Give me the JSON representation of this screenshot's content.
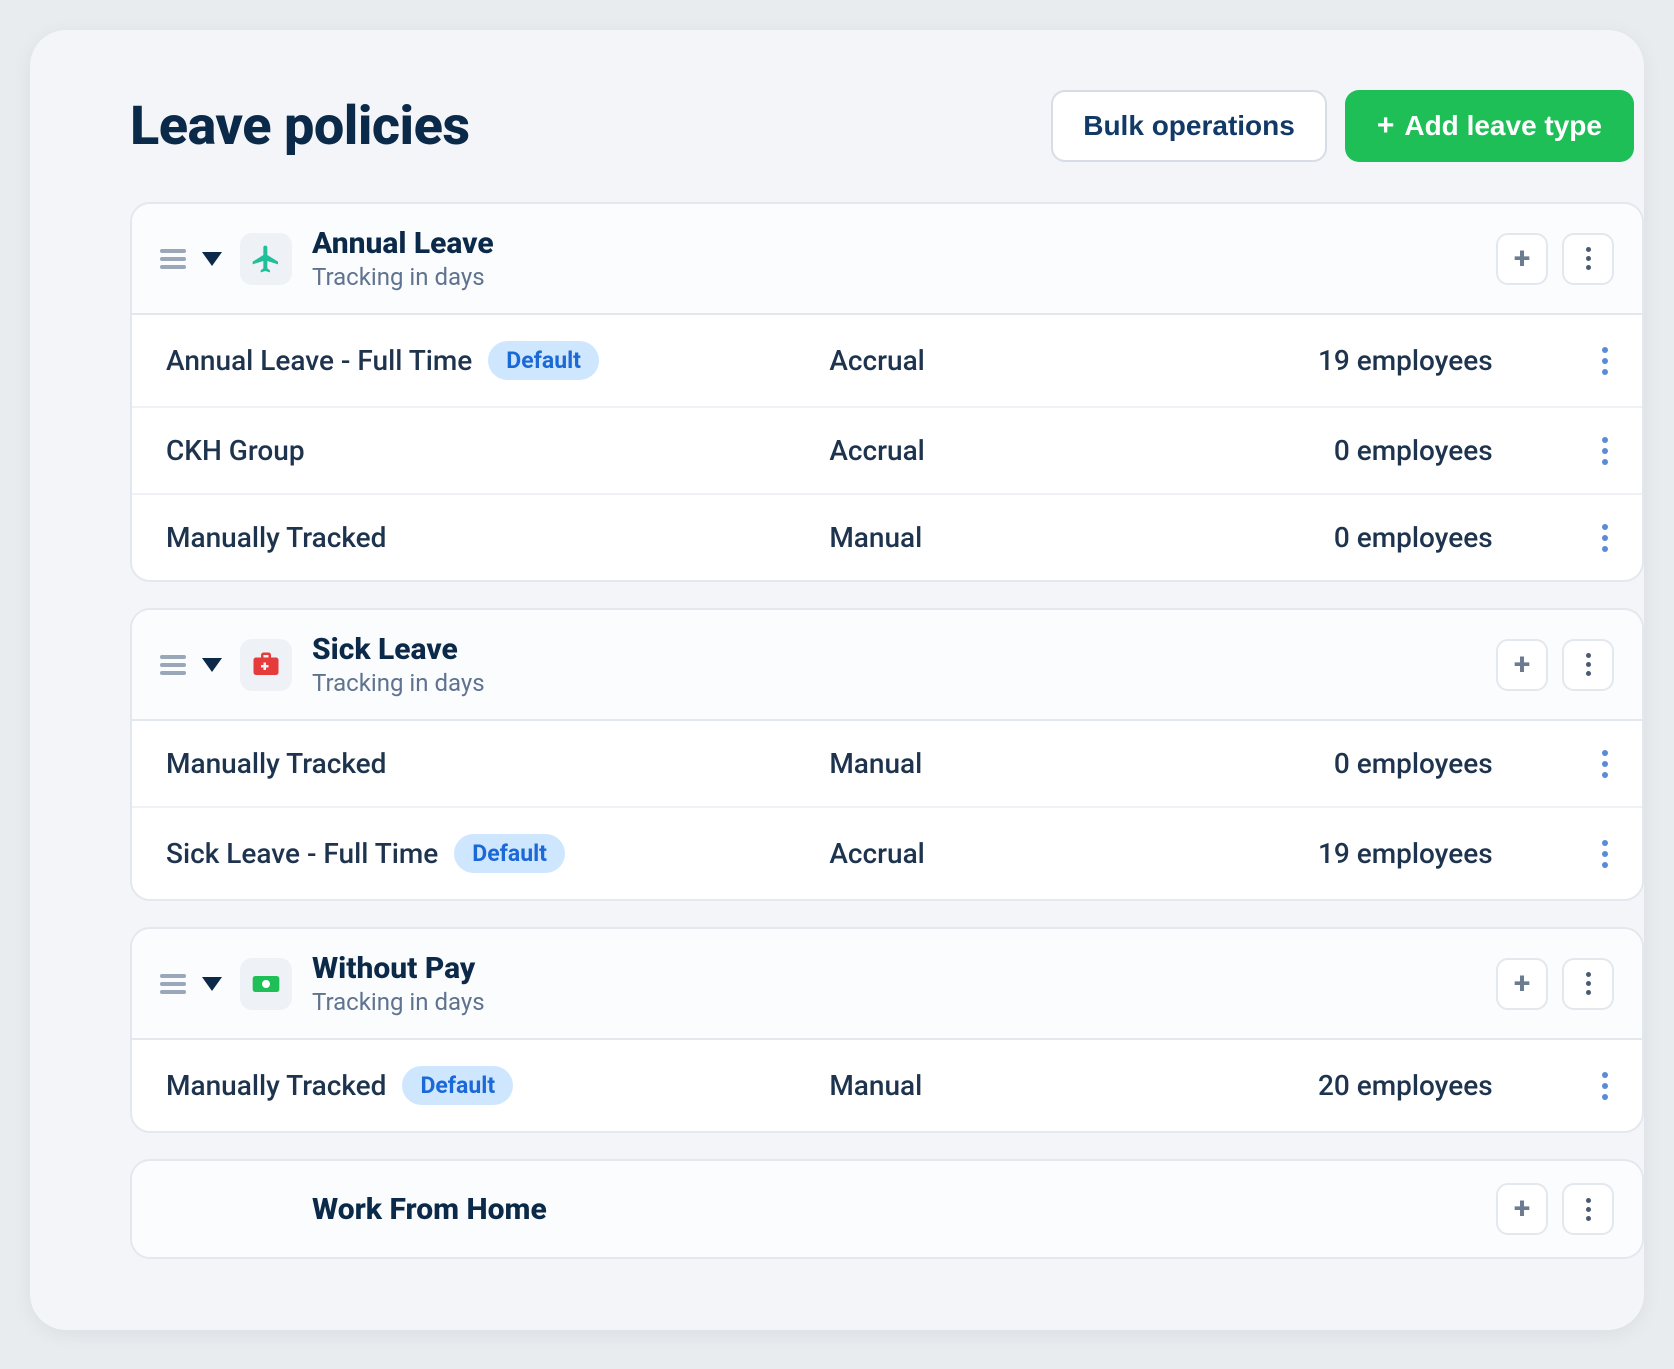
{
  "header": {
    "title": "Leave policies",
    "bulk_label": "Bulk operations",
    "add_label": "Add leave type"
  },
  "default_badge": "Default",
  "groups": [
    {
      "id": "annual",
      "title": "Annual Leave",
      "subtitle": "Tracking in days",
      "icon": "plane",
      "policies": [
        {
          "name": "Annual Leave - Full Time",
          "default": true,
          "mode": "Accrual",
          "count": "19 employees"
        },
        {
          "name": "CKH Group",
          "default": false,
          "mode": "Accrual",
          "count": "0 employees"
        },
        {
          "name": "Manually Tracked",
          "default": false,
          "mode": "Manual",
          "count": "0 employees"
        }
      ]
    },
    {
      "id": "sick",
      "title": "Sick Leave",
      "subtitle": "Tracking in days",
      "icon": "medkit",
      "policies": [
        {
          "name": "Manually Tracked",
          "default": false,
          "mode": "Manual",
          "count": "0 employees"
        },
        {
          "name": "Sick Leave - Full Time",
          "default": true,
          "mode": "Accrual",
          "count": "19 employees"
        }
      ]
    },
    {
      "id": "withoutpay",
      "title": "Without Pay",
      "subtitle": "Tracking in days",
      "icon": "cash",
      "policies": [
        {
          "name": "Manually Tracked",
          "default": true,
          "mode": "Manual",
          "count": "20 employees"
        }
      ]
    },
    {
      "id": "wfh",
      "title": "Work From Home",
      "subtitle": "",
      "icon": "",
      "policies": []
    }
  ]
}
